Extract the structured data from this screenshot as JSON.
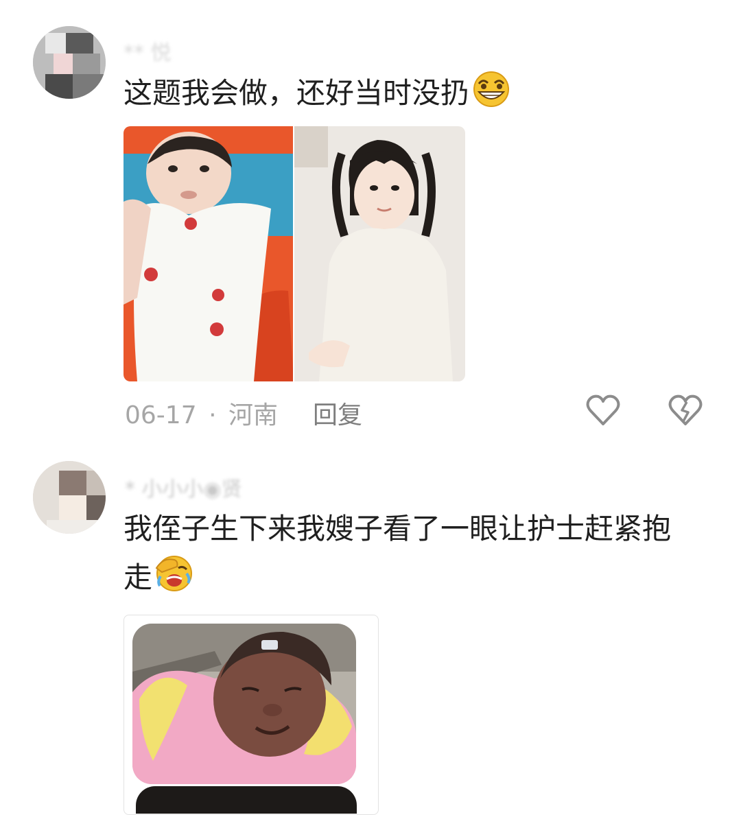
{
  "comments": [
    {
      "username": "** 悦",
      "text": "这题我会做，还好当时没扔",
      "emoji_icon": "grin-squint-emoji",
      "date": "06-17",
      "separator": "·",
      "location": "河南",
      "reply_label": "回复",
      "photos": [
        {
          "icon": "baby-in-white-dress-photo"
        },
        {
          "icon": "girl-with-pigtails-photo"
        }
      ]
    },
    {
      "username": "* 小小小◉贤",
      "text": "我侄子生下来我嫂子看了一眼让护士赶紧抱走",
      "emoji_icon": "facepalm-laughing-emoji",
      "photos": [
        {
          "icon": "newborn-in-pink-blanket-photo"
        }
      ]
    }
  ],
  "colors": {
    "meta_gray": "#a6a6a6",
    "reply_gray": "#7e7e7e",
    "icon_gray": "#8c8c8c",
    "emoji_yellow": "#f6c431"
  }
}
